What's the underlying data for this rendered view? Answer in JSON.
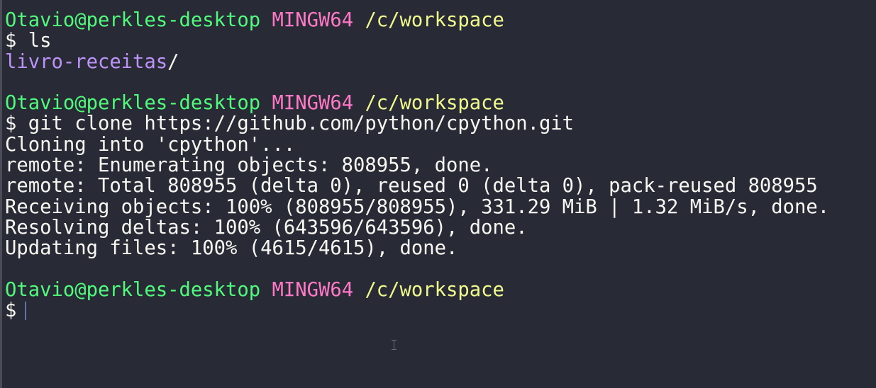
{
  "prompt": {
    "user_host": "Otavio@perkles-desktop",
    "env": "MINGW64",
    "cwd": "/c/workspace"
  },
  "session": {
    "cmd1": "$ ls",
    "ls_dir": "livro-receitas",
    "ls_slash": "/",
    "cmd2": "$ git clone https://github.com/python/cpython.git",
    "out1": "Cloning into 'cpython'...",
    "out2": "remote: Enumerating objects: 808955, done.",
    "out3": "remote: Total 808955 (delta 0), reused 0 (delta 0), pack-reused 808955",
    "out4": "Receiving objects: 100% (808955/808955), 331.29 MiB | 1.32 MiB/s, done.",
    "out5": "Resolving deltas: 100% (643596/643596), done.",
    "out6": "Updating files: 100% (4615/4615), done.",
    "prompt_symbol": "$"
  },
  "colors": {
    "background": "#282a36",
    "user_host": "#50fa7b",
    "env": "#ff79c6",
    "cwd": "#f1fa8c",
    "directory": "#bd93f9",
    "text": "#f8f8f2"
  }
}
